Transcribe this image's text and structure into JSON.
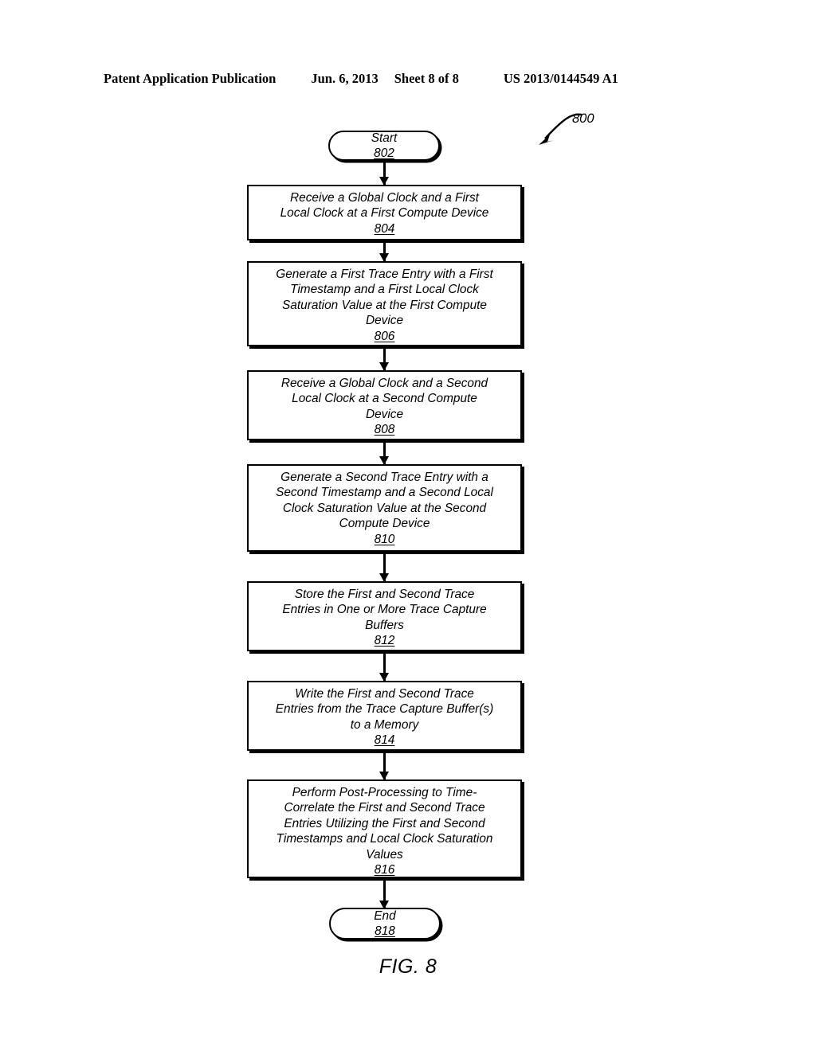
{
  "header": {
    "publication": "Patent Application Publication",
    "date": "Jun. 6, 2013",
    "sheet": "Sheet 8 of 8",
    "number": "US 2013/0144549 A1"
  },
  "figure": {
    "caption": "FIG. 8",
    "reference_numeral": "800"
  },
  "flowchart": {
    "nodes": [
      {
        "id": "start",
        "shape": "terminal",
        "lines": [
          "Start"
        ],
        "ref": "802"
      },
      {
        "id": "step-804",
        "shape": "process",
        "lines": [
          "Receive a Global Clock and a First",
          "Local Clock at a First Compute Device"
        ],
        "ref": "804"
      },
      {
        "id": "step-806",
        "shape": "process",
        "lines": [
          "Generate a First Trace Entry with a First",
          "Timestamp and a First Local Clock",
          "Saturation Value at the First Compute",
          "Device"
        ],
        "ref": "806"
      },
      {
        "id": "step-808",
        "shape": "process",
        "lines": [
          "Receive a Global Clock and a Second",
          "Local Clock at a Second Compute",
          "Device"
        ],
        "ref": "808"
      },
      {
        "id": "step-810",
        "shape": "process",
        "lines": [
          "Generate a Second Trace Entry with a",
          "Second Timestamp and a Second Local",
          "Clock Saturation Value at the Second",
          "Compute Device"
        ],
        "ref": "810"
      },
      {
        "id": "step-812",
        "shape": "process",
        "lines": [
          "Store the First and Second Trace",
          "Entries in One or More Trace Capture",
          "Buffers"
        ],
        "ref": "812"
      },
      {
        "id": "step-814",
        "shape": "process",
        "lines": [
          "Write the First and Second Trace",
          "Entries from the Trace Capture Buffer(s)",
          "to a Memory"
        ],
        "ref": "814"
      },
      {
        "id": "step-816",
        "shape": "process",
        "lines": [
          "Perform Post-Processing to Time-",
          "Correlate the First and Second Trace",
          "Entries Utilizing the First and Second",
          "Timestamps and Local Clock Saturation",
          "Values"
        ],
        "ref": "816"
      },
      {
        "id": "end",
        "shape": "terminal",
        "lines": [
          "End"
        ],
        "ref": "818"
      }
    ]
  },
  "colors": {
    "ink": "#000000",
    "paper": "#ffffff"
  }
}
